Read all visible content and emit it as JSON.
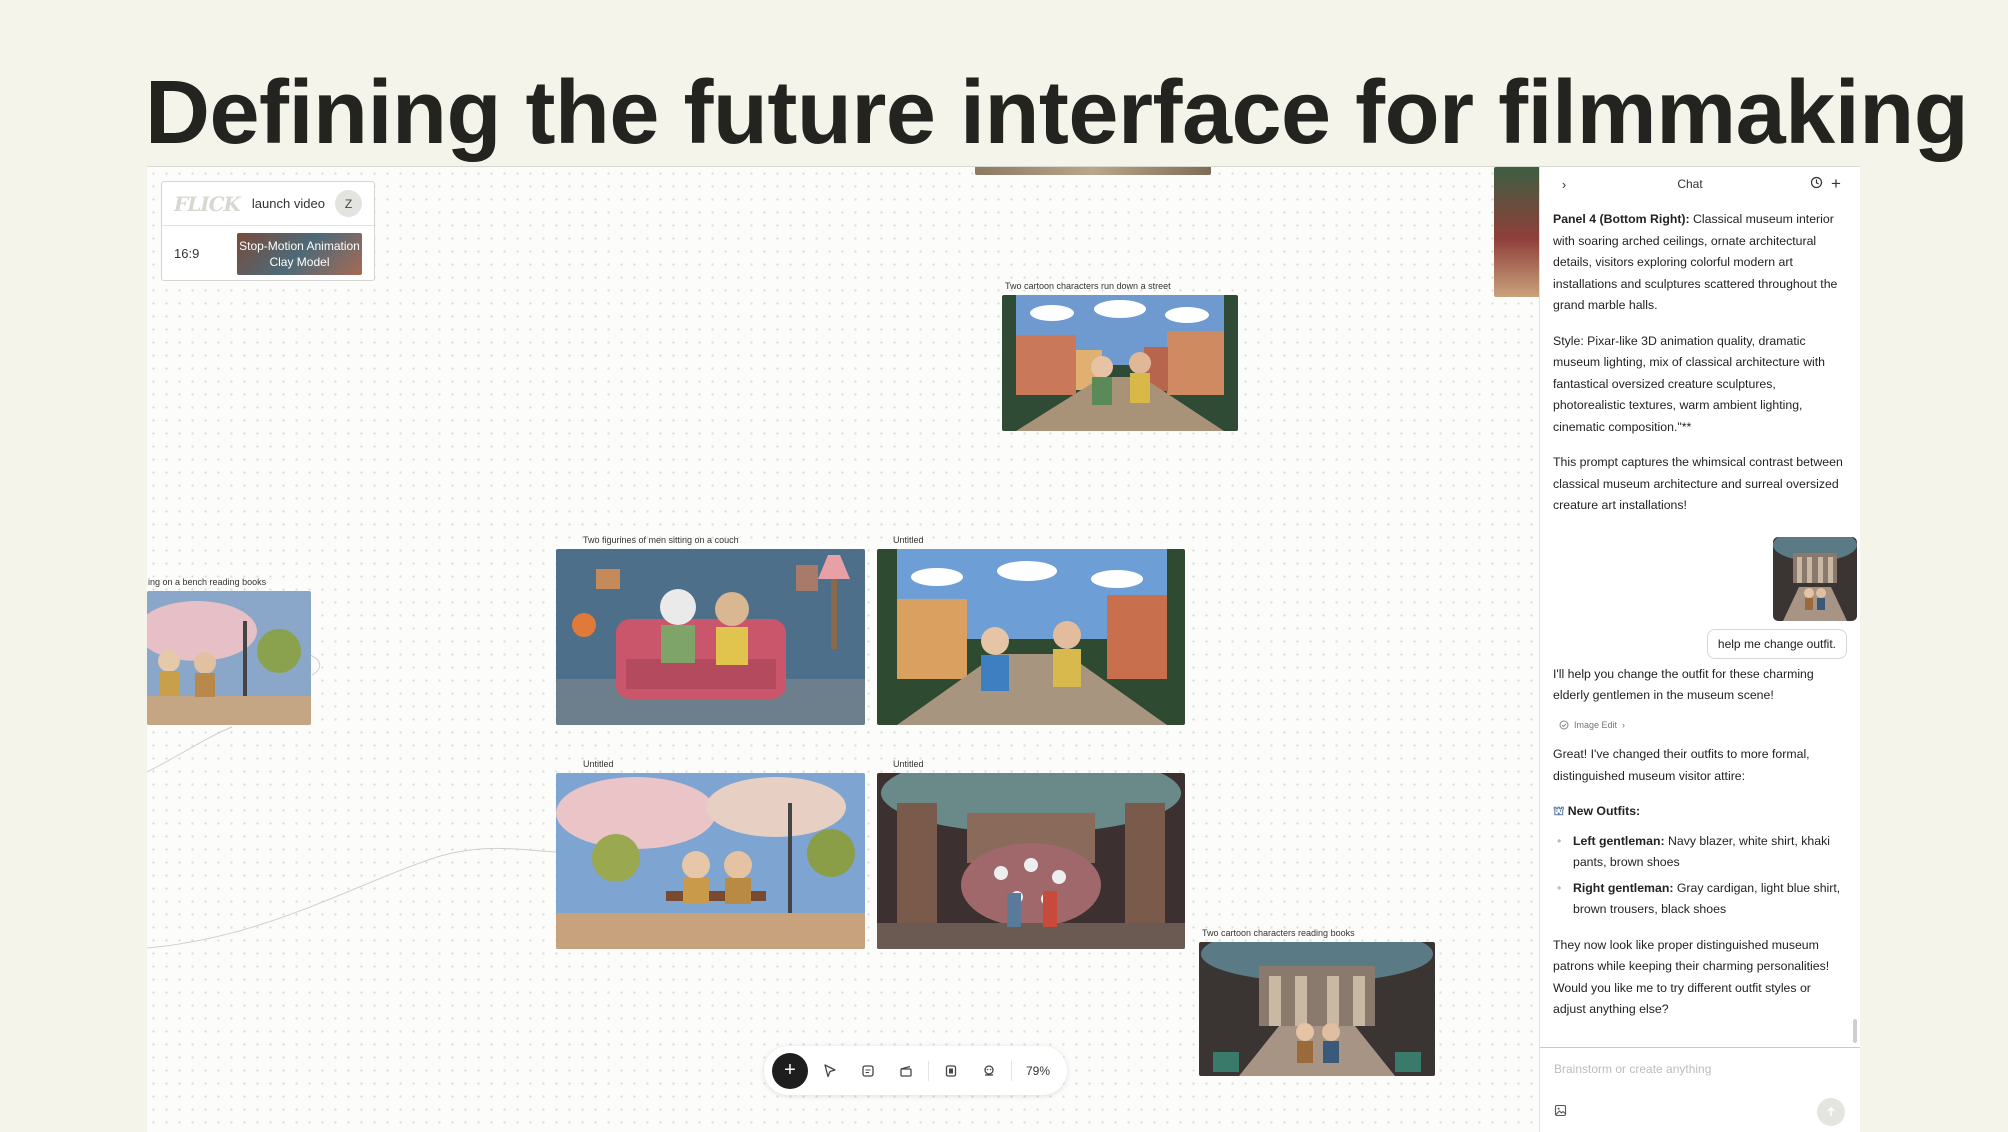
{
  "headline": "Defining the future interface for filmmaking",
  "project": {
    "logo_text": "FLICK",
    "name": "launch video",
    "user_initial": "Z",
    "aspect_ratio": "16:9",
    "style_label": "Stop-Motion Animation Clay Model"
  },
  "frames": [
    {
      "id": "f1",
      "label": "Two cartoon characters run down a street"
    },
    {
      "id": "f2",
      "label": "Two figurines of men sitting on a couch"
    },
    {
      "id": "f3",
      "label": "Untitled"
    },
    {
      "id": "f4",
      "label": "ing on a bench reading books"
    },
    {
      "id": "f5",
      "label": "Untitled"
    },
    {
      "id": "f6",
      "label": "Untitled"
    },
    {
      "id": "f7",
      "label": "Two cartoon characters reading books"
    }
  ],
  "toolbar": {
    "add_label": "+",
    "zoom": "79%"
  },
  "chat": {
    "title": "Chat",
    "msg1_bold": "Panel 4 (Bottom Right):",
    "msg1_text": " Classical museum interior with soaring arched ceilings, ornate architectural details, visitors exploring colorful modern art installations and sculptures scattered throughout the grand marble halls.",
    "msg2": "Style: Pixar-like 3D animation quality, dramatic museum lighting, mix of classical architecture with fantastical oversized creature sculptures, photorealistic textures, warm ambient lighting, cinematic composition.\"**",
    "msg3": "This prompt captures the whimsical contrast between classical museum architecture and surreal oversized creature art installations!",
    "user_msg": "help me change outfit.",
    "reply1": "I'll help you change the outfit for these charming elderly gentlemen in the museum scene!",
    "tool_chip": "Image Edit",
    "reply2": "Great! I've changed their outfits to more formal, distinguished museum visitor attire:",
    "outfits_heading": "New Outfits:",
    "outfits": [
      {
        "who": "Left gentleman:",
        "desc": " Navy blazer, white shirt, khaki pants, brown shoes"
      },
      {
        "who": "Right gentleman:",
        "desc": " Gray cardigan, light blue shirt, brown trousers, black shoes"
      }
    ],
    "reply3": "They now look like proper distinguished museum patrons while keeping their charming personalities! Would you like me to try different outfit styles or adjust anything else?",
    "input_placeholder": "Brainstorm or create anything"
  },
  "colors": {
    "page_bg": "#f5f4ea",
    "headline": "#23231f",
    "canvas_bg": "#fcfcfa",
    "accent_dark": "#1e1e1e"
  }
}
